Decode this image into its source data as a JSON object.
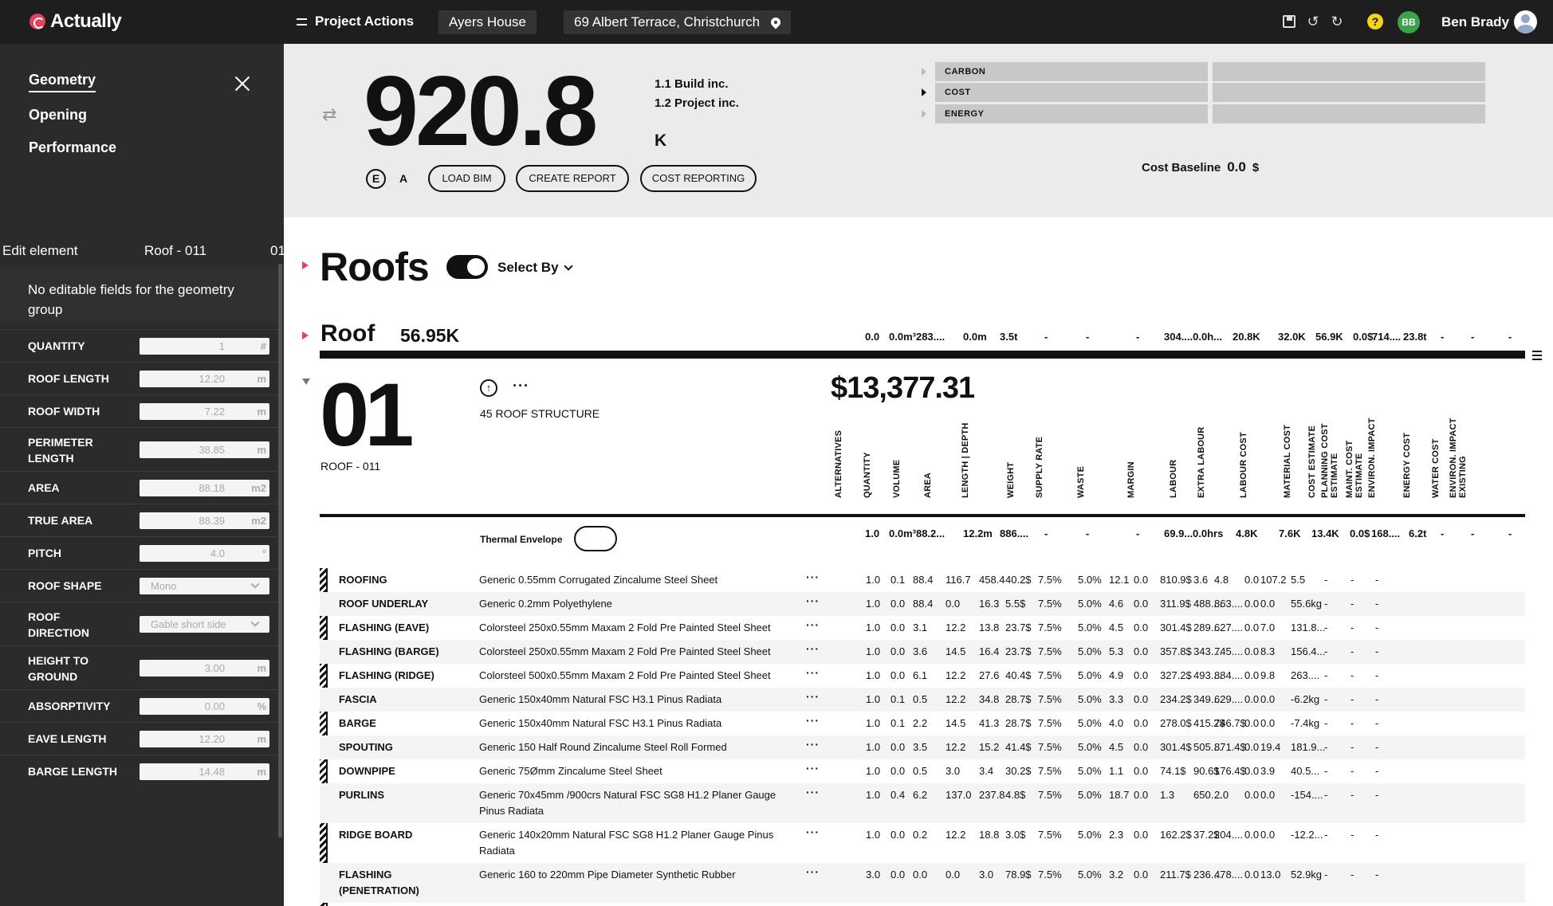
{
  "app": {
    "name": "Actually"
  },
  "topbar": {
    "project_actions": "Project Actions",
    "house": "Ayers House",
    "address": "69 Albert Terrace, Christchurch",
    "user_initials": "BB",
    "user_name": "Ben Brady",
    "help": "?"
  },
  "sidebar": {
    "nav": [
      "Geometry",
      "Opening",
      "Performance"
    ],
    "edit_label": "Edit element",
    "edit_element": "Roof - 011",
    "edit_index": "01",
    "no_edit_msg": "No editable fields for the geometry group",
    "fields": [
      {
        "label": "QUANTITY",
        "value": "1",
        "unit": "#"
      },
      {
        "label": "ROOF LENGTH",
        "value": "12.20",
        "unit": "m"
      },
      {
        "label": "ROOF WIDTH",
        "value": "7.22",
        "unit": "m"
      },
      {
        "label": "PERIMETER LENGTH",
        "value": "38.85",
        "unit": "m"
      },
      {
        "label": "AREA",
        "value": "88.18",
        "unit": "m2"
      },
      {
        "label": "TRUE AREA",
        "value": "88.39",
        "unit": "m2"
      },
      {
        "label": "PITCH",
        "value": "4.0",
        "unit": "°"
      },
      {
        "label": "ROOF SHAPE",
        "value": "Mono",
        "unit": "select"
      },
      {
        "label": "ROOF DIRECTION",
        "value": "Gable short side",
        "unit": "select"
      },
      {
        "label": "HEIGHT TO GROUND",
        "value": "3.00",
        "unit": "m"
      },
      {
        "label": "ABSORPTIVITY",
        "value": "0.00",
        "unit": "%"
      },
      {
        "label": "EAVE LENGTH",
        "value": "12.20",
        "unit": "m"
      },
      {
        "label": "BARGE LENGTH",
        "value": "14.48",
        "unit": "m"
      }
    ]
  },
  "summary": {
    "value": "920.8",
    "unit": "K",
    "inc1": "1.1 Build inc.",
    "inc2": "1.2 Project inc.",
    "e_badge": "E",
    "a_label": "A",
    "buttons": [
      "LOAD BIM",
      "CREATE REPORT",
      "COST REPORTING"
    ],
    "metrics": [
      "CARBON",
      "COST",
      "ENERGY"
    ],
    "baseline_label": "Cost Baseline",
    "baseline_value": "0.0",
    "baseline_unit": "$"
  },
  "section": {
    "title": "Roofs",
    "select_by": "Select By",
    "group_title": "Roof",
    "group_total": "56.95K",
    "group_summary": [
      "0.0",
      "0.0m³283....",
      "0.0m",
      "3.5t",
      "-",
      "-",
      "-",
      "304....0.0h...",
      "20.8K",
      "32.0K",
      "56.9K",
      "0.0$",
      "714....",
      "23.8t",
      "-",
      "-",
      "-"
    ]
  },
  "element": {
    "number": "01",
    "name": "ROOF - 011",
    "category": "45 ROOF STRUCTURE",
    "price": "$13,377.31",
    "thermal_label": "Thermal Envelope",
    "columns": [
      "ALTERNATIVES",
      "QUANTITY",
      "VOLUME",
      "AREA",
      "LENGTH | DEPTH",
      "WEIGHT",
      "SUPPLY RATE",
      "WASTE",
      "MARGIN",
      "LABOUR",
      "EXTRA LABOUR",
      "LABOUR COST",
      "MATERIAL COST",
      "COST ESTIMATE",
      "PLANNING COST ESTIMATE",
      "MAINT. COST ESTIMATE",
      "ENVIRON. IMPACT",
      "ENERGY COST",
      "WATER COST",
      "ENVIRON. IMPACT EXISTING"
    ],
    "summary": [
      "1.0",
      "0.0m³88.2...",
      "12.2m",
      "886....",
      "-",
      "-",
      "-",
      "69.9...",
      "0.0hrs",
      "4.8K",
      "7.6K",
      "13.4K",
      "0.0$",
      "168....",
      "6.2t",
      "-",
      "-",
      "-"
    ]
  },
  "rows": [
    {
      "name": "ROOFING",
      "desc": "Generic 0.55mm Corrugated Zincalume Steel Sheet",
      "more": "···",
      "vals": [
        "1.0",
        "0.1",
        "88.4",
        "116.7",
        "458.4",
        "40.2$",
        "7.5%",
        "5.0%",
        "12.1",
        "0.0",
        "810.9$",
        "3.6",
        "4.8",
        "0.0",
        "107.2",
        "5.5",
        "-",
        "-",
        "-"
      ]
    },
    {
      "name": "ROOF UNDERLAY",
      "desc": "Generic 0.2mm Polyethylene",
      "more": "···",
      "vals": [
        "1.0",
        "0.0",
        "88.4",
        "0.0",
        "16.3",
        "5.5$",
        "7.5%",
        "5.0%",
        "4.6",
        "0.0",
        "311.9$",
        "488....",
        "863....",
        "0.0",
        "0.0",
        "55.6kg",
        "-",
        "-",
        "-"
      ]
    },
    {
      "name": "FLASHING (EAVE)",
      "desc": "Colorsteel 250x0.55mm Maxam 2 Fold Pre Painted Steel Sheet",
      "more": "···",
      "vals": [
        "1.0",
        "0.0",
        "3.1",
        "12.2",
        "13.8",
        "23.7$",
        "7.5%",
        "5.0%",
        "4.5",
        "0.0",
        "301.4$",
        "289....",
        "627....",
        "0.0",
        "7.0",
        "131.8...",
        "-",
        "-",
        "-"
      ]
    },
    {
      "name": "FLASHING (BARGE)",
      "desc": "Colorsteel 250x0.55mm Maxam 2 Fold Pre Painted Steel Sheet",
      "more": "···",
      "vals": [
        "1.0",
        "0.0",
        "3.6",
        "14.5",
        "16.4",
        "23.7$",
        "7.5%",
        "5.0%",
        "5.3",
        "0.0",
        "357.8$",
        "343....",
        "745....",
        "0.0",
        "8.3",
        "156.4...",
        "-",
        "-",
        "-"
      ]
    },
    {
      "name": "FLASHING (RIDGE)",
      "desc": "Colorsteel 500x0.55mm Maxam 2 Fold Pre Painted Steel Sheet",
      "more": "···",
      "vals": [
        "1.0",
        "0.0",
        "6.1",
        "12.2",
        "27.6",
        "40.4$",
        "7.5%",
        "5.0%",
        "4.9",
        "0.0",
        "327.2$",
        "493....",
        "884....",
        "0.0",
        "9.8",
        "263....",
        "-",
        "-",
        "-"
      ]
    },
    {
      "name": "FASCIA",
      "desc": "Generic 150x40mm Natural FSC H3.1 Pinus Radiata",
      "more": "···",
      "vals": [
        "1.0",
        "0.1",
        "0.5",
        "12.2",
        "34.8",
        "28.7$",
        "7.5%",
        "5.0%",
        "3.3",
        "0.0",
        "234.2$",
        "349....",
        "629....",
        "0.0",
        "0.0",
        "-6.2kg",
        "-",
        "-",
        "-"
      ]
    },
    {
      "name": "BARGE",
      "desc": "Generic 150x40mm Natural FSC H3.1 Pinus Radiata",
      "more": "···",
      "vals": [
        "1.0",
        "0.1",
        "2.2",
        "14.5",
        "41.3",
        "28.7$",
        "7.5%",
        "5.0%",
        "4.0",
        "0.0",
        "278.0$",
        "415.2$",
        "746.7$",
        "0.0",
        "0.0",
        "-7.4kg",
        "-",
        "-",
        "-"
      ]
    },
    {
      "name": "SPOUTING",
      "desc": "Generic 150 Half Round Zincalume Steel Roll Formed",
      "more": "···",
      "vals": [
        "1.0",
        "0.0",
        "3.5",
        "12.2",
        "15.2",
        "41.4$",
        "7.5%",
        "5.0%",
        "4.5",
        "0.0",
        "301.4$",
        "505....",
        "871.4$",
        "0.0",
        "19.4",
        "181.9...",
        "-",
        "-",
        "-"
      ]
    },
    {
      "name": "DOWNPIPE",
      "desc": "Generic 75Ømm Zincalume Steel Sheet",
      "more": "···",
      "vals": [
        "1.0",
        "0.0",
        "0.5",
        "3.0",
        "3.4",
        "30.2$",
        "7.5%",
        "5.0%",
        "1.1",
        "0.0",
        "74.1$",
        "90.6$",
        "176.4$",
        "0.0",
        "3.9",
        "40.5...",
        "-",
        "-",
        "-"
      ]
    },
    {
      "name": "PURLINS",
      "desc": "Generic 70x45mm /900crs Natural FSC SG8 H1.2 Planer Gauge Pinus Radiata",
      "more": "···",
      "vals": [
        "1.0",
        "0.4",
        "6.2",
        "137.0",
        "237.8",
        "4.8$",
        "7.5%",
        "5.0%",
        "18.7",
        "0.0",
        "1.3",
        "650....",
        "2.0",
        "0.0",
        "0.0",
        "-154....",
        "-",
        "-",
        "-"
      ]
    },
    {
      "name": "RIDGE BOARD",
      "desc": "Generic 140x20mm Natural FSC SG8 H1.2 Planer Gauge Pinus Radiata",
      "more": "···",
      "vals": [
        "1.0",
        "0.0",
        "0.2",
        "12.2",
        "18.8",
        "3.0$",
        "7.5%",
        "5.0%",
        "2.3",
        "0.0",
        "162.2$",
        "37.2$",
        "204....",
        "0.0",
        "0.0",
        "-12.2...",
        "-",
        "-",
        "-"
      ]
    },
    {
      "name": "FLASHING (PENETRATION)",
      "desc": "Generic 160 to 220mm Pipe Diameter Synthetic Rubber",
      "more": "···",
      "vals": [
        "3.0",
        "0.0",
        "0.0",
        "0.0",
        "3.0",
        "78.9$",
        "7.5%",
        "5.0%",
        "3.2",
        "0.0",
        "211.7$",
        "236....",
        "478....",
        "0.0",
        "13.0",
        "52.9kg",
        "-",
        "-",
        "-"
      ]
    }
  ]
}
